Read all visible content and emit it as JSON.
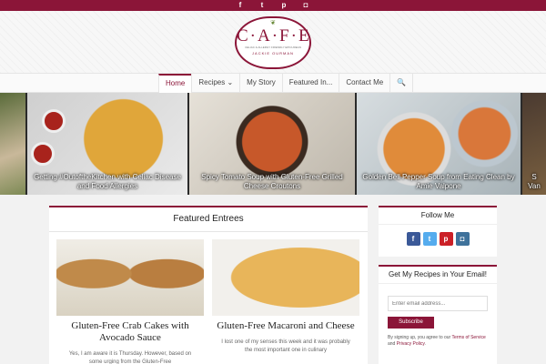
{
  "topbar": {
    "icons": [
      {
        "name": "facebook-icon",
        "glyph": "f"
      },
      {
        "name": "twitter-icon",
        "glyph": "t"
      },
      {
        "name": "pinterest-icon",
        "glyph": "p"
      },
      {
        "name": "instagram-icon",
        "glyph": "◘"
      }
    ]
  },
  "logo": {
    "leaf": "❦",
    "brand": "C·A·F·E",
    "tagline": "CELIAC & ALLERGY FRIENDLY EPICUREAN",
    "author": "JACKIE OURMAN"
  },
  "nav": {
    "home": "Home",
    "recipes": "Recipes ⌄",
    "my_story": "My Story",
    "featured": "Featured In...",
    "contact": "Contact Me",
    "search": "🔍"
  },
  "slider": {
    "slides": [
      {
        "caption": ""
      },
      {
        "caption": "Getting #OutoftheKitchen with Celiac Disease and Food Allergies"
      },
      {
        "caption": "Spicy Tomato Soup with Gluten-Free Grilled Cheese Croutons"
      },
      {
        "caption": "Golden Bell Pepper Soup from Eating Clean by Amie Valpone"
      },
      {
        "caption": "S Van"
      }
    ]
  },
  "featured": {
    "title": "Featured Entrees",
    "cards": [
      {
        "title": "Gluten-Free Crab Cakes with Avocado Sauce",
        "excerpt": "Yes, I am aware it is Thursday. However, based on some urging from the Gluten-Free"
      },
      {
        "title": "Gluten-Free Macaroni and Cheese",
        "excerpt": "I lost one of my senses this week and it was probably  the most important one in culinary"
      }
    ]
  },
  "follow": {
    "title": "Follow Me",
    "icons": [
      {
        "name": "facebook-icon",
        "glyph": "f"
      },
      {
        "name": "twitter-icon",
        "glyph": "t"
      },
      {
        "name": "pinterest-icon",
        "glyph": "p"
      },
      {
        "name": "instagram-icon",
        "glyph": "◘"
      }
    ]
  },
  "newsletter": {
    "title": "Get My Recipes in Your Email!",
    "placeholder": "Enter email address...",
    "button": "Subscribe",
    "fine_pre": "By signing up, you agree to our ",
    "terms": "Terms of Service",
    "fine_mid": " and ",
    "privacy": "Privacy Policy",
    "fine_post": "."
  },
  "colors": {
    "accent": "#8b1538",
    "facebook": "#3b5998",
    "twitter": "#55acee",
    "pinterest": "#cb2027",
    "instagram": "#3f729b"
  }
}
